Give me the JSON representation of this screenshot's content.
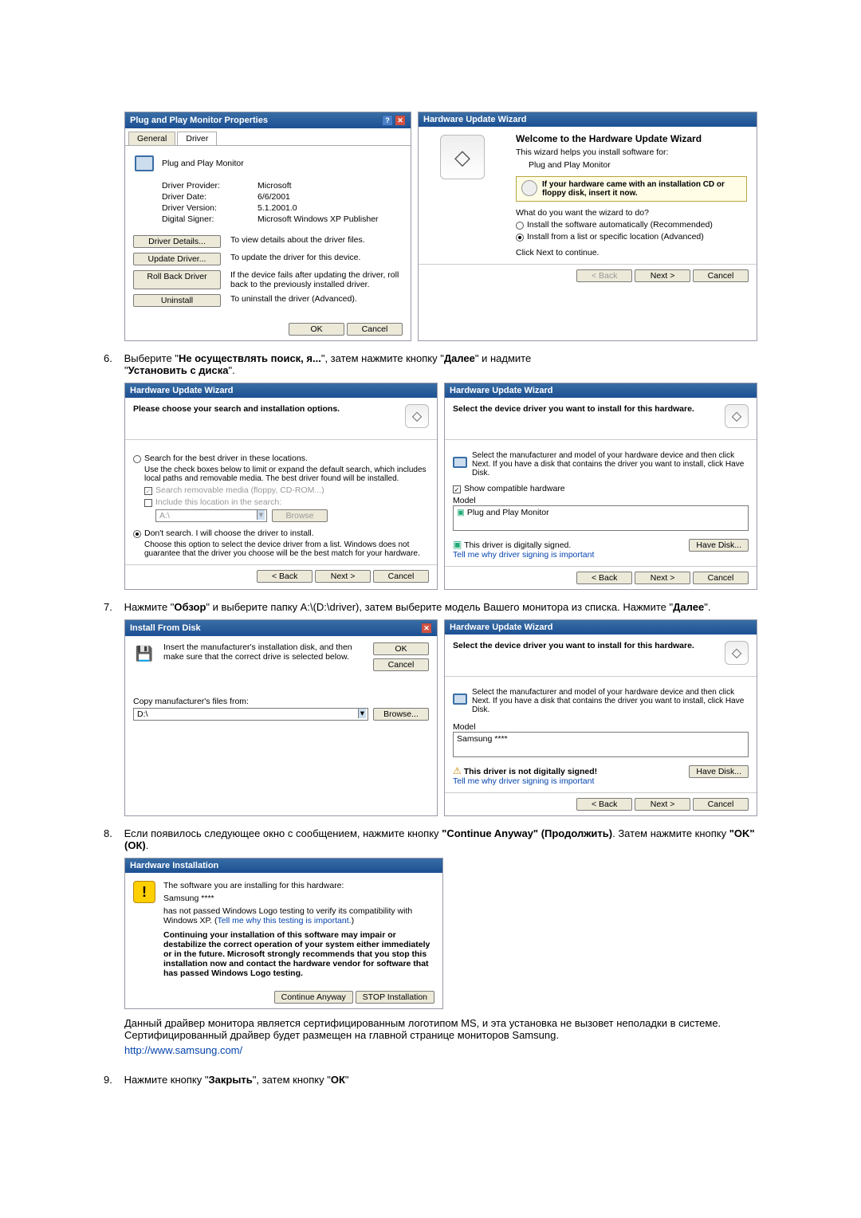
{
  "properties_dialog": {
    "title": "Plug and Play Monitor Properties",
    "help_btn": "?",
    "close_btn": "✕",
    "tabs": {
      "general": "General",
      "driver": "Driver"
    },
    "heading": "Plug and Play Monitor",
    "rows": {
      "provider_lbl": "Driver Provider:",
      "provider_val": "Microsoft",
      "date_lbl": "Driver Date:",
      "date_val": "6/6/2001",
      "version_lbl": "Driver Version:",
      "version_val": "5.1.2001.0",
      "signer_lbl": "Digital Signer:",
      "signer_val": "Microsoft Windows XP Publisher"
    },
    "actions": {
      "details_btn": "Driver Details...",
      "details_desc": "To view details about the driver files.",
      "update_btn": "Update Driver...",
      "update_desc": "To update the driver for this device.",
      "rollback_btn": "Roll Back Driver",
      "rollback_desc": "If the device fails after updating the driver, roll back to the previously installed driver.",
      "uninstall_btn": "Uninstall",
      "uninstall_desc": "To uninstall the driver (Advanced)."
    },
    "ok": "OK",
    "cancel": "Cancel"
  },
  "wizard1": {
    "title": "Hardware Update Wizard",
    "welcome": "Welcome to the Hardware Update Wizard",
    "intro": "This wizard helps you install software for:",
    "device": "Plug and Play Monitor",
    "cd_hint": "If your hardware came with an installation CD or floppy disk, insert it now.",
    "question": "What do you want the wizard to do?",
    "opt1": "Install the software automatically (Recommended)",
    "opt2": "Install from a list or specific location (Advanced)",
    "proceed": "Click Next to continue.",
    "back": "< Back",
    "next": "Next >",
    "cancel": "Cancel"
  },
  "step6": {
    "line_a": "Выберите \"",
    "line_b": "Не осуществлять поиск, я...",
    "line_c": "\", затем нажмите кнопку \"",
    "line_d": "Далее",
    "line_e": "\" и надмите",
    "line_f": "\"",
    "line_g": "Установить с диска",
    "line_h": "\"."
  },
  "wizard2": {
    "title": "Hardware Update Wizard",
    "header": "Please choose your search and installation options.",
    "opt_search": "Search for the best driver in these locations.",
    "search_desc": "Use the check boxes below to limit or expand the default search, which includes local paths and removable media. The best driver found will be installed.",
    "chk_removable": "Search removable media (floppy, CD-ROM...)",
    "chk_include": "Include this location in the search:",
    "path": "A:\\",
    "browse": "Browse",
    "opt_dont": "Don't search. I will choose the driver to install.",
    "dont_desc": "Choose this option to select the device driver from a list. Windows does not guarantee that the driver you choose will be the best match for your hardware.",
    "back": "< Back",
    "next": "Next >",
    "cancel": "Cancel"
  },
  "wizard3": {
    "title": "Hardware Update Wizard",
    "header": "Select the device driver you want to install for this hardware.",
    "instr": "Select the manufacturer and model of your hardware device and then click Next. If you have a disk that contains the driver you want to install, click Have Disk.",
    "show_compat": "Show compatible hardware",
    "model_label": "Model",
    "model_item": "Plug and Play Monitor",
    "signed": "This driver is digitally signed.",
    "tell_me": "Tell me why driver signing is important",
    "have_disk": "Have Disk...",
    "back": "< Back",
    "next": "Next >",
    "cancel": "Cancel"
  },
  "step7": {
    "line_a": "Нажмите \"",
    "line_b": "Обзор",
    "line_c": "\" и выберите папку A:\\(D:\\driver), затем выберите модель Вашего монитора из списка. Нажмите \"",
    "line_d": "Далее",
    "line_e": "\"."
  },
  "install_disk": {
    "title": "Install From Disk",
    "close": "✕",
    "instr": "Insert the manufacturer's installation disk, and then make sure that the correct drive is selected below.",
    "ok": "OK",
    "cancel": "Cancel",
    "copy_lbl": "Copy manufacturer's files from:",
    "path": "D:\\",
    "browse": "Browse..."
  },
  "wizard4": {
    "title": "Hardware Update Wizard",
    "header": "Select the device driver you want to install for this hardware.",
    "instr": "Select the manufacturer and model of your hardware device and then click Next. If you have a disk that contains the driver you want to install, click Have Disk.",
    "model_label": "Model",
    "model_item": "Samsung ****",
    "unsigned": "This driver is not digitally signed!",
    "tell_me": "Tell me why driver signing is important",
    "have_disk": "Have Disk...",
    "back": "< Back",
    "next": "Next >",
    "cancel": "Cancel"
  },
  "step8": {
    "line_a": "Если появилось следующее окно с сообщением, нажмите кнопку ",
    "line_b": "\"Continue Anyway\" (Продолжить)",
    "line_c": ". Затем нажмите кнопку ",
    "line_d": "\"OK\" (ОК)",
    "line_e": "."
  },
  "hw_install": {
    "title": "Hardware Installation",
    "line1": "The software you are installing for this hardware:",
    "device": "Samsung ****",
    "line2a": "has not passed Windows Logo testing to verify its compatibility with Windows XP. (",
    "line2b": "Tell me why this testing is important.",
    "line2c": ")",
    "warn": "Continuing your installation of this software may impair or destabilize the correct operation of your system either immediately or in the future. Microsoft strongly recommends that you stop this installation now and contact the hardware vendor for software that has passed Windows Logo testing.",
    "cont": "Continue Anyway",
    "stop": "STOP Installation"
  },
  "cert_note": "Данный драйвер монитора является сертифицированным логотипом MS, и эта установка не вызовет неполадки в системе. Сертифицированный драйвер будет размещен на главной странице мониторов Samsung.",
  "cert_link": "http://www.samsung.com/",
  "step9": {
    "line_a": "Нажмите кнопку \"",
    "line_b": "Закрыть",
    "line_c": "\", затем кнопку \"",
    "line_d": "ОК",
    "line_e": "\""
  },
  "numbers": {
    "n6": "6.",
    "n7": "7.",
    "n8": "8.",
    "n9": "9."
  }
}
